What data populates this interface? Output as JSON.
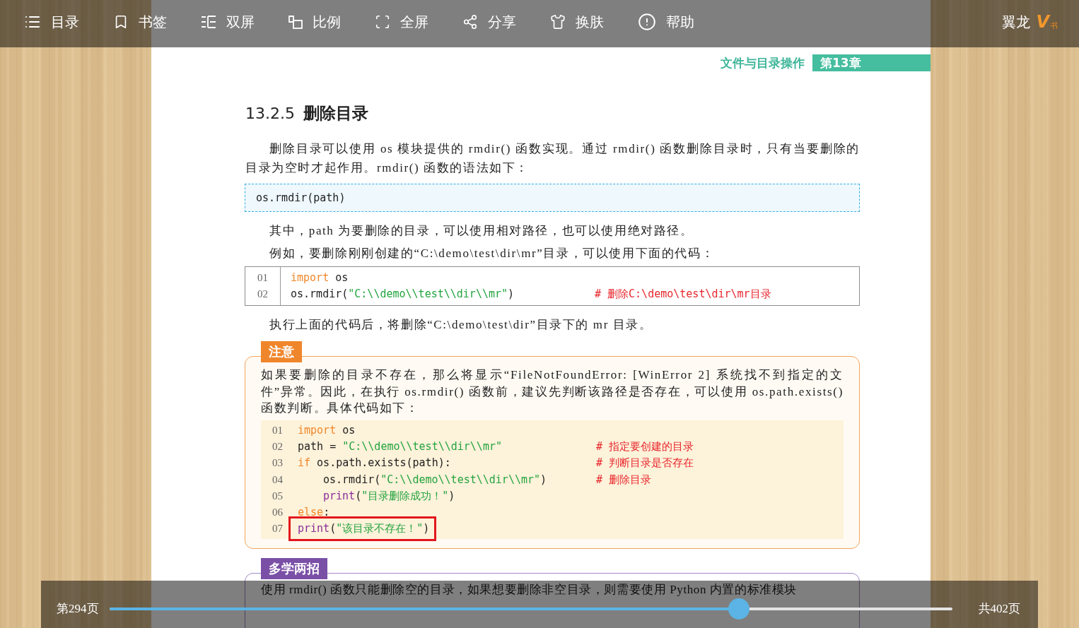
{
  "toolbar": {
    "items": [
      {
        "kind": "contents",
        "label": "目录"
      },
      {
        "kind": "bookmark",
        "label": "书签"
      },
      {
        "kind": "dual",
        "label": "双屏"
      },
      {
        "kind": "scale",
        "label": "比例"
      },
      {
        "kind": "fullscreen",
        "label": "全屏"
      },
      {
        "kind": "share",
        "label": "分享"
      },
      {
        "kind": "skin",
        "label": "换肤"
      },
      {
        "kind": "help",
        "label": "帮助"
      }
    ],
    "brand": {
      "name": "翼龙",
      "logo_mark": "V",
      "logo_sub": "书"
    }
  },
  "page": {
    "running_head": {
      "section": "文件与目录操作",
      "chapter": "第13章"
    },
    "blocks": [
      {
        "kind": "heading",
        "number": "13.2.5",
        "title": "删除目录"
      },
      {
        "kind": "paragraph",
        "text": "删除目录可以使用 os 模块提供的 rmdir() 函数实现。通过 rmdir() 函数删除目录时，只有当要删除的目录为空时才起作用。rmdir() 函数的语法如下："
      },
      {
        "kind": "syntax",
        "text": "os.rmdir(path)"
      },
      {
        "kind": "paragraph",
        "text": "其中，path 为要删除的目录，可以使用相对路径，也可以使用绝对路径。"
      },
      {
        "kind": "paragraph",
        "text": "例如，要删除刚刚创建的“C:\\demo\\test\\dir\\mr”目录，可以使用下面的代码："
      },
      {
        "kind": "code",
        "lines": [
          {
            "number": "01",
            "tokens": [
              {
                "kind": "keyword",
                "text": "import"
              },
              {
                "kind": "plain",
                "text": " os"
              }
            ]
          },
          {
            "number": "02",
            "tokens": [
              {
                "kind": "plain",
                "text": "os.rmdir("
              },
              {
                "kind": "string",
                "text": "\"C:\\\\demo\\\\test\\\\dir\\\\mr\""
              },
              {
                "kind": "plain",
                "text": ")"
              }
            ],
            "comment": "# 删除C:\\demo\\test\\dir\\mr目录"
          }
        ]
      },
      {
        "kind": "paragraph",
        "text": "执行上面的代码后，将删除“C:\\demo\\test\\dir”目录下的 mr 目录。"
      },
      {
        "kind": "note",
        "label": "注意",
        "text": "如果要删除的目录不存在，那么将显示“FileNotFoundError: [WinError 2] 系统找不到指定的文件”异常。因此，在执行 os.rmdir() 函数前，建议先判断该路径是否存在，可以使用 os.path.exists() 函数判断。具体代码如下：",
        "code": [
          {
            "number": "01",
            "highlighted": false,
            "tokens": [
              {
                "kind": "keyword",
                "text": "import"
              },
              {
                "kind": "plain",
                "text": " os"
              }
            ]
          },
          {
            "number": "02",
            "highlighted": false,
            "tokens": [
              {
                "kind": "plain",
                "text": "path = "
              },
              {
                "kind": "string",
                "text": "\"C:\\\\demo\\\\test\\\\dir\\\\mr\""
              }
            ],
            "comment": "# 指定要创建的目录"
          },
          {
            "number": "03",
            "highlighted": false,
            "tokens": [
              {
                "kind": "keyword",
                "text": "if"
              },
              {
                "kind": "plain",
                "text": " os.path.exists(path):"
              }
            ],
            "comment": "# 判断目录是否存在",
            "children": [
              {
                "number": "04",
                "highlighted": false,
                "tokens": [
                  {
                    "kind": "plain",
                    "text": "os.rmdir("
                  },
                  {
                    "kind": "string",
                    "text": "\"C:\\\\demo\\\\test\\\\dir\\\\mr\""
                  },
                  {
                    "kind": "plain",
                    "text": ")"
                  }
                ],
                "comment": "# 删除目录"
              },
              {
                "number": "05",
                "highlighted": false,
                "tokens": [
                  {
                    "kind": "builtin",
                    "text": "print"
                  },
                  {
                    "kind": "plain",
                    "text": "("
                  },
                  {
                    "kind": "string",
                    "text": "\"目录删除成功！\""
                  },
                  {
                    "kind": "plain",
                    "text": ")"
                  }
                ]
              }
            ]
          },
          {
            "number": "06",
            "highlighted": false,
            "tokens": [
              {
                "kind": "keyword",
                "text": "else"
              },
              {
                "kind": "plain",
                "text": ":"
              }
            ]
          },
          {
            "number": "07",
            "highlighted": true,
            "tokens": [
              {
                "kind": "builtin",
                "text": "print"
              },
              {
                "kind": "plain",
                "text": "("
              },
              {
                "kind": "string",
                "text": "\"该目录不存在！\""
              },
              {
                "kind": "plain",
                "text": ")"
              }
            ]
          }
        ]
      },
      {
        "kind": "tip",
        "label": "多学两招",
        "text": "使用 rmdir() 函数只能删除空的目录，如果想要删除非空目录，则需要使用 Python 内置的标准模块"
      }
    ]
  },
  "footer": {
    "current_page": "第294页",
    "slider": {
      "level": 0.747
    },
    "total_pages": "共402页"
  }
}
